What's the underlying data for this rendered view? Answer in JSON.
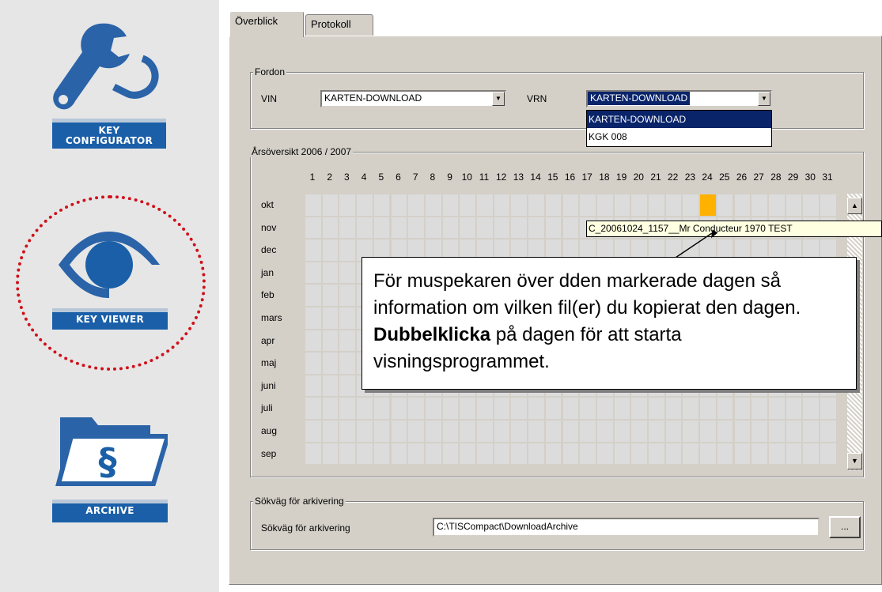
{
  "sidebar": {
    "configurator": {
      "label_line1": "KEY",
      "label_line2": "CONFIGURATOR",
      "icon": "wrench-icon"
    },
    "viewer": {
      "label": "KEY VIEWER",
      "icon": "eye-icon"
    },
    "archive": {
      "label": "ARCHIVE",
      "icon": "folder-paragraph-icon"
    }
  },
  "tabs": [
    {
      "label": "Överblick",
      "active": true
    },
    {
      "label": "Protokoll",
      "active": false
    }
  ],
  "fordon": {
    "legend": "Fordon",
    "vin_label": "VIN",
    "vin_value": "KARTEN-DOWNLOAD",
    "vrn_label": "VRN",
    "vrn_value": "KARTEN-DOWNLOAD",
    "vrn_options": [
      "KARTEN-DOWNLOAD",
      "KGK 008"
    ]
  },
  "overview": {
    "legend": "Årsöversikt 2006 / 2007",
    "days": [
      "1",
      "2",
      "3",
      "4",
      "5",
      "6",
      "7",
      "8",
      "9",
      "10",
      "11",
      "12",
      "13",
      "14",
      "15",
      "16",
      "17",
      "18",
      "19",
      "20",
      "21",
      "22",
      "23",
      "24",
      "25",
      "26",
      "27",
      "28",
      "29",
      "30",
      "31"
    ],
    "months": [
      "okt",
      "nov",
      "dec",
      "jan",
      "feb",
      "mars",
      "apr",
      "maj",
      "juni",
      "juli",
      "aug",
      "sep"
    ],
    "marked": [
      {
        "month": "okt",
        "day": 24
      }
    ],
    "tooltip": "C_20061024_1157__Mr Conducteur 1970 TEST"
  },
  "callout": {
    "text_1": "För muspekaren över dden markerade dagen så information om vilken fil(er) du kopierat den dagen.",
    "bold": "Dubbelklicka",
    "text_2": "på dagen för att starta visningsprogrammet."
  },
  "archive_path": {
    "legend": "Sökväg för arkivering",
    "label": "Sökväg för arkivering",
    "value": "C:\\TISCompact\\DownloadArchive",
    "browse_label": "..."
  },
  "colors": {
    "mark": "#ffb100",
    "sidebar_label": "#1a5fa8",
    "highlight_circle": "#d0101a"
  }
}
